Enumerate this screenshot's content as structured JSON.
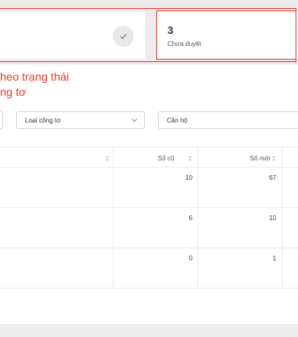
{
  "stats": [
    {
      "count": "",
      "label": ""
    },
    {
      "count": "3",
      "label": "Chưa duyệt"
    }
  ],
  "annotation": {
    "line1": "heo trạng thái",
    "line2": "ng tơ"
  },
  "filters": {
    "meter_type": "Loại công tơ",
    "apartment": "Căn hộ"
  },
  "table": {
    "columns": [
      "",
      "Số cũ",
      "Số mới"
    ],
    "rows": [
      {
        "old": "10",
        "new": "67"
      },
      {
        "old": "6",
        "new": "10"
      },
      {
        "old": "0",
        "new": "1"
      }
    ]
  },
  "colors": {
    "annotation": "#e8392f",
    "accent_text": "#2d2d48"
  }
}
